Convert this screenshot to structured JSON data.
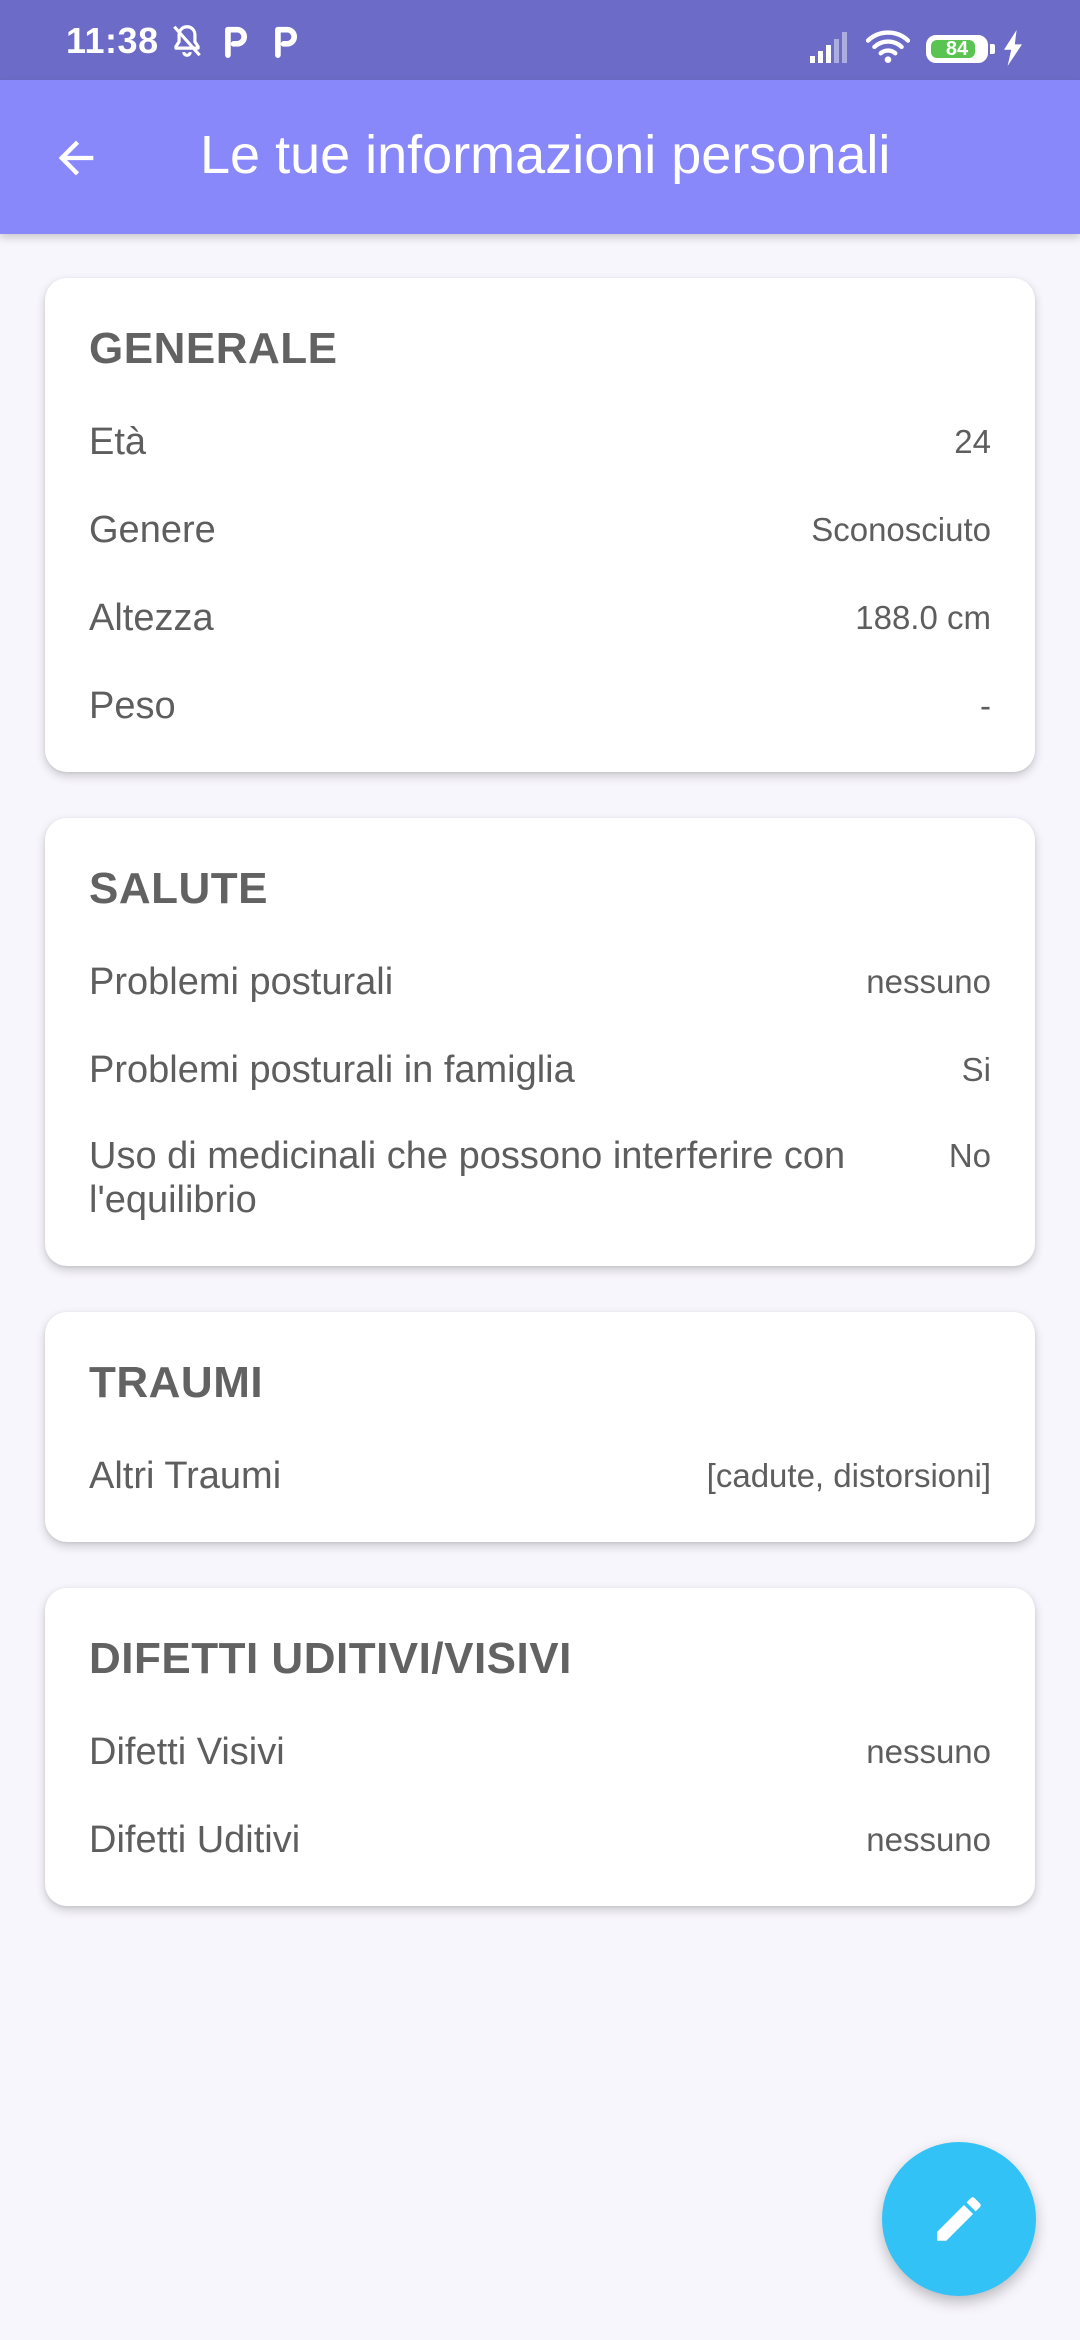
{
  "status_bar": {
    "time": "11:38",
    "battery_level": "84",
    "battery_fraction": 0.84,
    "icons": [
      "bell-off-icon",
      "p-notification-icon",
      "p-notification-icon",
      "signal-icon",
      "wifi-icon",
      "battery-icon",
      "charging-icon"
    ]
  },
  "app_bar": {
    "title": "Le tue informazioni personali",
    "back_icon": "arrow-back-icon",
    "color": "#8988FB"
  },
  "sections": {
    "generale": {
      "title": "GENERALE",
      "rows": [
        {
          "label": "Età",
          "value": "24"
        },
        {
          "label": "Genere",
          "value": "Sconosciuto"
        },
        {
          "label": "Altezza",
          "value": "188.0 cm"
        },
        {
          "label": "Peso",
          "value": "-"
        }
      ]
    },
    "salute": {
      "title": "SALUTE",
      "rows": [
        {
          "label": "Problemi posturali",
          "value": "nessuno"
        },
        {
          "label": "Problemi posturali in famiglia",
          "value": "Si"
        },
        {
          "label": "Uso di medicinali che possono interferire con l'equilibrio",
          "value": "No"
        }
      ]
    },
    "traumi": {
      "title": "TRAUMI",
      "rows": [
        {
          "label": "Altri Traumi",
          "value": "[cadute, distorsioni]"
        }
      ]
    },
    "difetti": {
      "title": "DIFETTI UDITIVI/VISIVI",
      "rows": [
        {
          "label": "Difetti Visivi",
          "value": "nessuno"
        },
        {
          "label": "Difetti Uditivi",
          "value": "nessuno"
        }
      ]
    }
  },
  "fab": {
    "icon": "edit-pencil-icon",
    "color": "#32C2F6"
  }
}
